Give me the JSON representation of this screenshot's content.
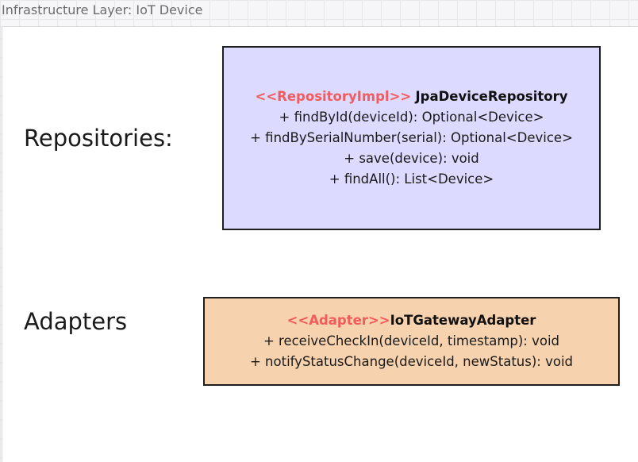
{
  "frame": {
    "title": "Infrastructure Layer: IoT Device"
  },
  "sections": {
    "repositories_label": "Repositories:",
    "adapters_label": "Adapters"
  },
  "repository_box": {
    "stereotype": "<<RepositoryImpl>>",
    "class_name": "JpaDeviceRepository",
    "methods": [
      "+ findById(deviceId): Optional<Device>",
      "+ findBySerialNumber(serial): Optional<Device>",
      "+ save(device): void",
      "+ findAll(): List<Device>"
    ],
    "fill_color": "#dcdaff"
  },
  "adapter_box": {
    "stereotype": "<<Adapter>>",
    "class_name": "IoTGatewayAdapter",
    "methods": [
      "+ receiveCheckIn(deviceId, timestamp): void",
      "+ notifyStatusChange(deviceId, newStatus): void"
    ],
    "fill_color": "#f7d2ae"
  },
  "colors": {
    "stereotype": "#f25c5c",
    "border": "#1e1e1e",
    "canvas_background": "#f6f6f8"
  }
}
